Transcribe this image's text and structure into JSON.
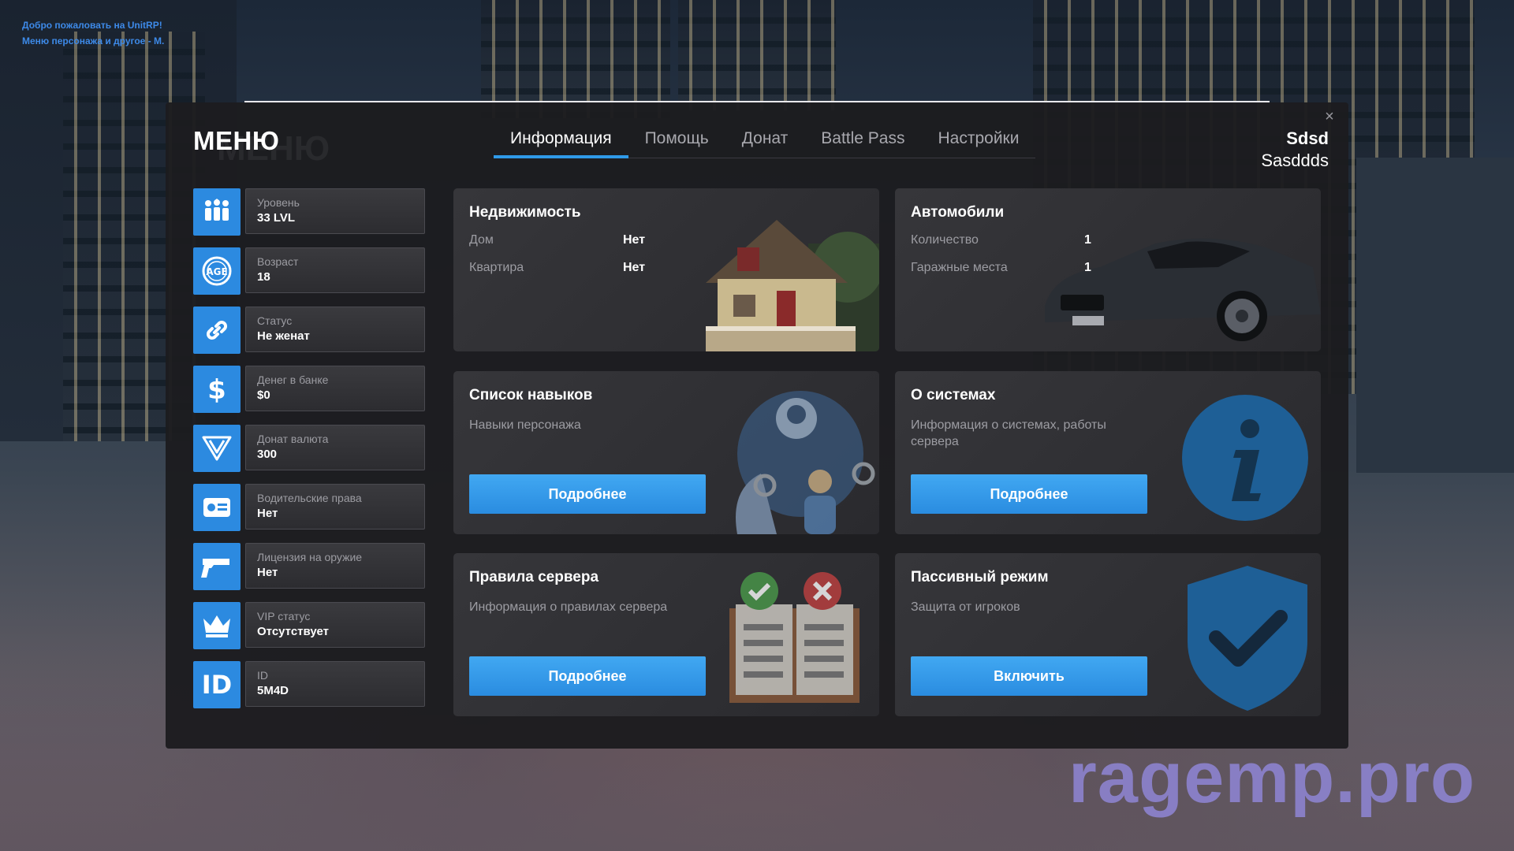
{
  "overlay": {
    "welcome_line1": "Добро пожаловать на UnitRP!",
    "welcome_line2": "Меню персонажа и другое - M.",
    "watermark": "ragemp.pro"
  },
  "header": {
    "menu_title": "МЕНЮ",
    "menu_ghost": "МЕНЮ",
    "close_glyph": "×"
  },
  "tabs": [
    {
      "label": "Информация",
      "active": true
    },
    {
      "label": "Помощь",
      "active": false
    },
    {
      "label": "Донат",
      "active": false
    },
    {
      "label": "Battle Pass",
      "active": false
    },
    {
      "label": "Настройки",
      "active": false
    }
  ],
  "user": {
    "first_name": "Sdsd",
    "last_name": "Sasddds"
  },
  "stats": [
    {
      "icon": "level-people-icon",
      "label": "Уровень",
      "value": "33 LVL"
    },
    {
      "icon": "age-badge-icon",
      "label": "Возраст",
      "value": "18"
    },
    {
      "icon": "link-rings-icon",
      "label": "Статус",
      "value": "Не женат"
    },
    {
      "icon": "dollar-icon",
      "label": "Денег в банке",
      "value": "$0"
    },
    {
      "icon": "donate-currency-icon",
      "label": "Донат валюта",
      "value": "300"
    },
    {
      "icon": "driver-license-icon",
      "label": "Водительские права",
      "value": "Нет"
    },
    {
      "icon": "gun-icon",
      "label": "Лицензия на оружие",
      "value": "Нет"
    },
    {
      "icon": "crown-icon",
      "label": "VIP статус",
      "value": "Отсутствует"
    },
    {
      "icon": "id-icon",
      "label": "ID",
      "value": "5M4D",
      "glyph": "ID"
    }
  ],
  "cards": {
    "realty": {
      "title": "Недвижимость",
      "rows": [
        {
          "label": "Дом",
          "value": "Нет"
        },
        {
          "label": "Квартира",
          "value": "Нет"
        }
      ]
    },
    "cars": {
      "title": "Автомобили",
      "rows": [
        {
          "label": "Количество",
          "value": "1"
        },
        {
          "label": "Гаражные места",
          "value": "1"
        }
      ]
    },
    "skills": {
      "title": "Список навыков",
      "desc": "Навыки персонажа",
      "button": "Подробнее"
    },
    "systems": {
      "title": "О системах",
      "desc": "Информация о системах, работы сервера",
      "button": "Подробнее"
    },
    "rules": {
      "title": "Правила сервера",
      "desc": "Информация о правилах сервера",
      "button": "Подробнее"
    },
    "passive": {
      "title": "Пассивный режим",
      "desc": "Защита от игроков",
      "button": "Включить"
    }
  },
  "colors": {
    "accent": "#2f9ae8",
    "button": "#3a9eec",
    "panel": "#1c1c1f"
  }
}
